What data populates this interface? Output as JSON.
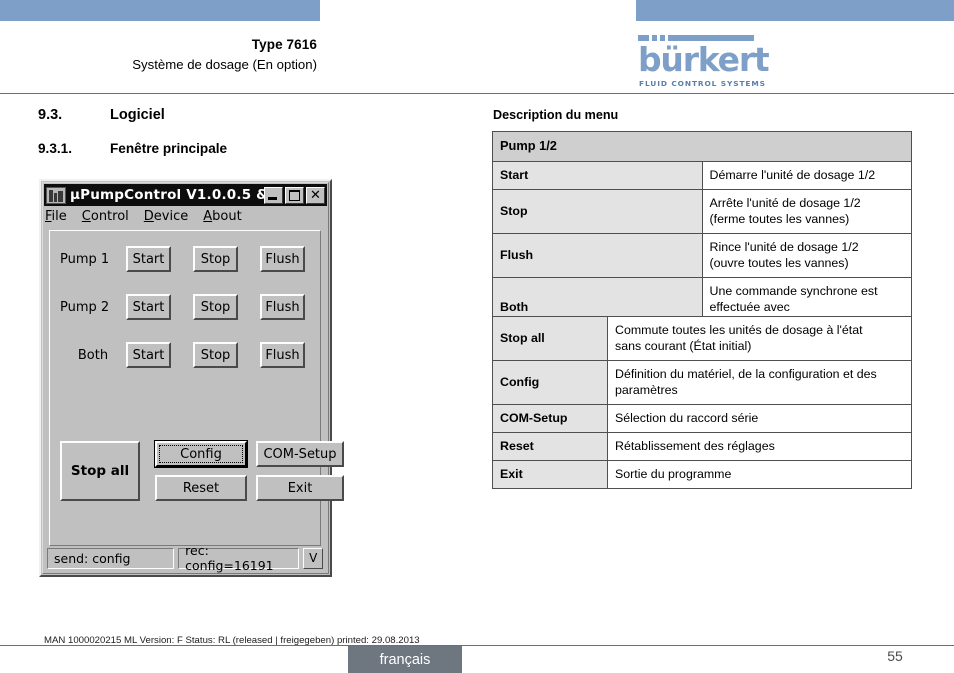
{
  "header": {
    "type_title": "Type 7616",
    "subtitle": "Système de dosage (En option)",
    "logo_word": "bürkert",
    "logo_tagline": "FLUID CONTROL SYSTEMS",
    "accent_color": "#7e9fc8"
  },
  "sections": {
    "s93_num": "9.3.",
    "s93_label": "Logiciel",
    "s931_num": "9.3.1.",
    "s931_label": "Fenêtre principale"
  },
  "app_window": {
    "title": "µPumpControl V1.0.0.5 & ...",
    "menu": [
      {
        "label": "File",
        "accel": "F"
      },
      {
        "label": "Control",
        "accel": "C"
      },
      {
        "label": "Device",
        "accel": "D"
      },
      {
        "label": "About",
        "accel": "A"
      }
    ],
    "window_buttons": {
      "minimize": "minimize-icon",
      "maximize": "maximize-icon",
      "close": "close-icon"
    },
    "pump_rows": [
      {
        "label": "Pump 1",
        "buttons": [
          "Start",
          "Stop",
          "Flush"
        ]
      },
      {
        "label": "Pump 2",
        "buttons": [
          "Start",
          "Stop",
          "Flush"
        ]
      },
      {
        "label": "Both",
        "buttons": [
          "Start",
          "Stop",
          "Flush"
        ]
      }
    ],
    "actions": {
      "stop_all": "Stop all",
      "config": "Config",
      "com_setup": "COM-Setup",
      "reset": "Reset",
      "exit": "Exit"
    },
    "status": {
      "send": "send: config",
      "rec": "rec: config=16191",
      "expand": "V"
    }
  },
  "right": {
    "desc_title": "Description du menu",
    "table1": {
      "header": "Pump 1/2",
      "rows": [
        {
          "key": "Start",
          "value": "Démarre l'unité de dosage 1/2"
        },
        {
          "key": "Stop",
          "value": "Arrête l'unité de dosage 1/2\n(ferme toutes les vannes)"
        },
        {
          "key": "Flush",
          "value": "Rince l'unité de dosage 1/2\n(ouvre toutes les vannes)"
        },
        {
          "key": "Both",
          "value": "Une commande synchrone est effectuée avec\n« Both »"
        }
      ]
    },
    "table2": {
      "rows": [
        {
          "key": "Stop all",
          "value": "Commute toutes les unités de dosage à l'état\nsans courant (État initial)"
        },
        {
          "key": "Config",
          "value": "Définition du matériel, de la configuration et des\nparamètres"
        },
        {
          "key": "COM-Setup",
          "value": "Sélection du raccord série"
        },
        {
          "key": "Reset",
          "value": "Rétablissement des réglages"
        },
        {
          "key": "Exit",
          "value": "Sortie du programme"
        }
      ]
    }
  },
  "footer": {
    "meta": "MAN 1000020215 ML  Version: F Status: RL (released | freigegeben)  printed: 29.08.2013",
    "language": "français",
    "page": "55"
  }
}
